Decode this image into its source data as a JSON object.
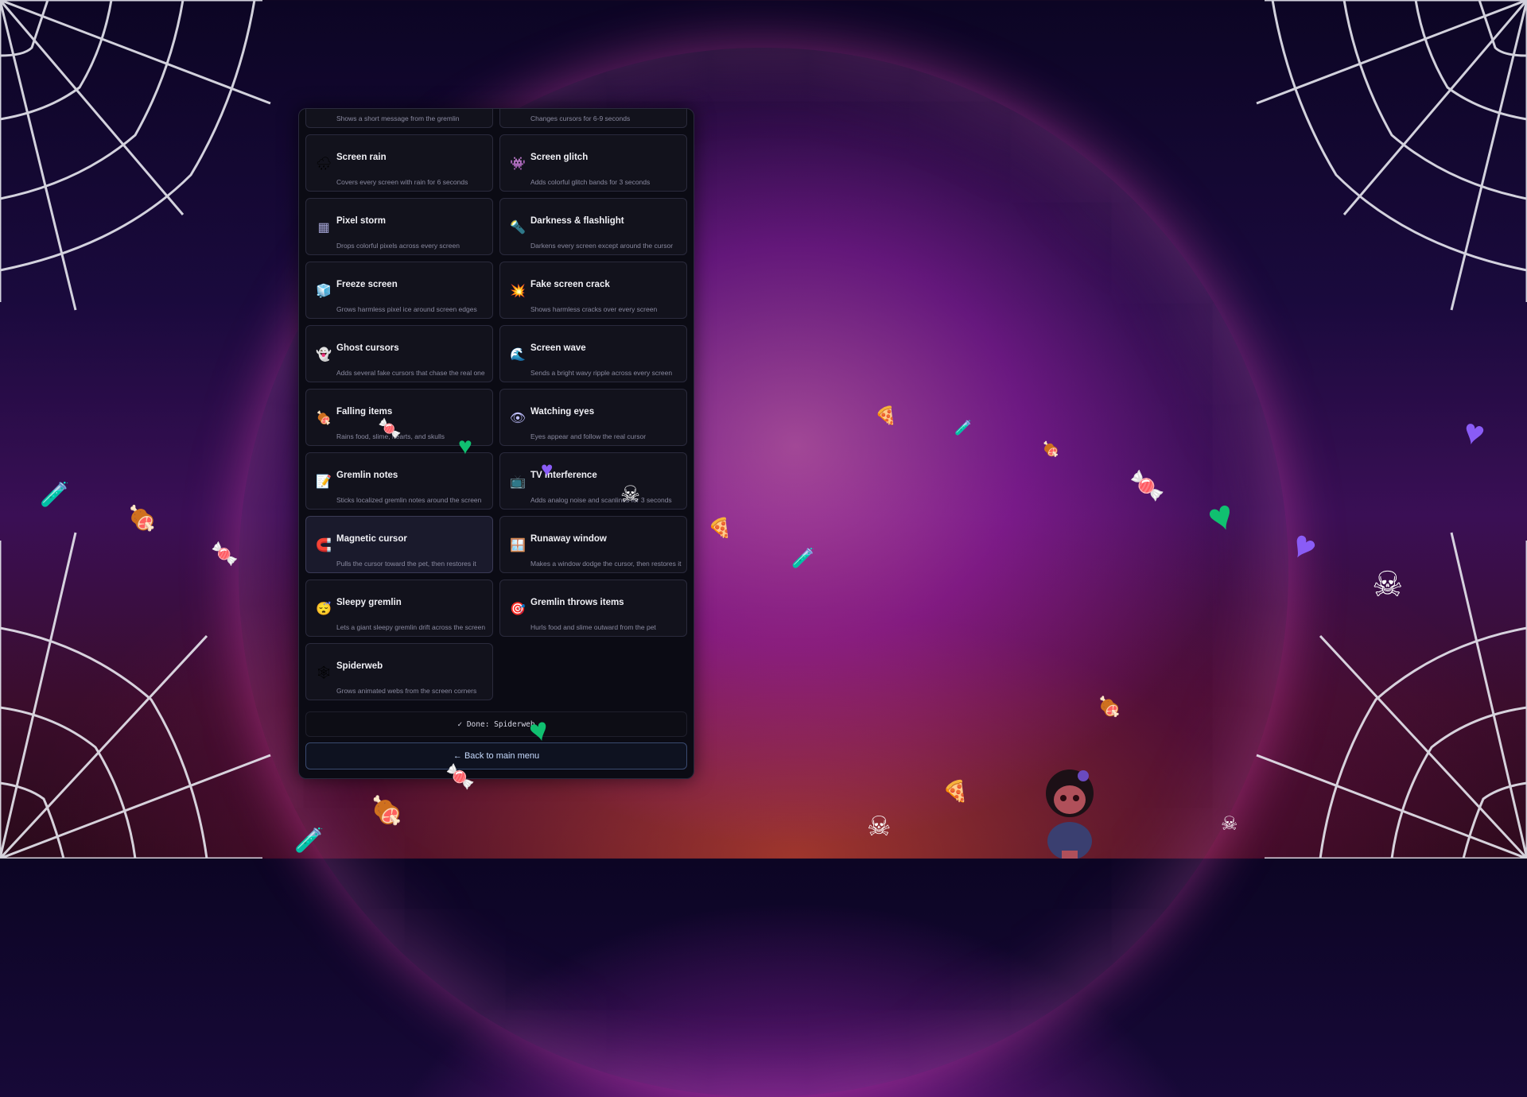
{
  "panel": {
    "cards": [
      {
        "title": "",
        "desc": "Shows a short message from the gremlin",
        "icon": "",
        "variant": "top"
      },
      {
        "title": "",
        "desc": "Changes cursors for 6-9 seconds",
        "icon": "",
        "variant": "top"
      },
      {
        "title": "Screen rain",
        "desc": "Covers every screen with rain for 6 seconds",
        "icon": "🌧"
      },
      {
        "title": "Screen glitch",
        "desc": "Adds colorful glitch bands for 3 seconds",
        "icon": "👾"
      },
      {
        "title": "Pixel storm",
        "desc": "Drops colorful pixels across every screen",
        "icon": "▦"
      },
      {
        "title": "Darkness & flashlight",
        "desc": "Darkens every screen except around the cursor",
        "icon": "🔦"
      },
      {
        "title": "Freeze screen",
        "desc": "Grows harmless pixel ice around screen edges",
        "icon": "🧊"
      },
      {
        "title": "Fake screen crack",
        "desc": "Shows harmless cracks over every screen",
        "icon": "💥"
      },
      {
        "title": "Ghost cursors",
        "desc": "Adds several fake cursors that chase the real one",
        "icon": "👻"
      },
      {
        "title": "Screen wave",
        "desc": "Sends a bright wavy ripple across every screen",
        "icon": "🌊"
      },
      {
        "title": "Falling items",
        "desc": "Rains food, slime, hearts, and skulls",
        "icon": "🍖"
      },
      {
        "title": "Watching eyes",
        "desc": "Eyes appear and follow the real cursor",
        "icon": "👁"
      },
      {
        "title": "Gremlin notes",
        "desc": "Sticks localized gremlin notes around the screen",
        "icon": "📝"
      },
      {
        "title": "TV interference",
        "desc": "Adds analog noise and scanlines for 3 seconds",
        "icon": "📺"
      },
      {
        "title": "Magnetic cursor",
        "desc": "Pulls the cursor toward the pet, then restores it",
        "icon": "🧲",
        "selected": true
      },
      {
        "title": "Runaway window",
        "desc": "Makes a window dodge the cursor, then restores it",
        "icon": "🪟"
      },
      {
        "title": "Sleepy gremlin",
        "desc": "Lets a giant sleepy gremlin drift across the screen",
        "icon": "😴"
      },
      {
        "title": "Gremlin throws items",
        "desc": "Hurls food and slime outward from the pet",
        "icon": "🎯"
      },
      {
        "title": "Spiderweb",
        "desc": "Grows animated webs from the screen corners",
        "icon": "🕸"
      }
    ],
    "status_text": "✓ Done: Spiderweb",
    "back_button": "← Back to main menu"
  },
  "colors": {
    "panel_bg": "#0b0b14",
    "card_bg": "#12121c",
    "accent_border": "#3a4a70"
  }
}
